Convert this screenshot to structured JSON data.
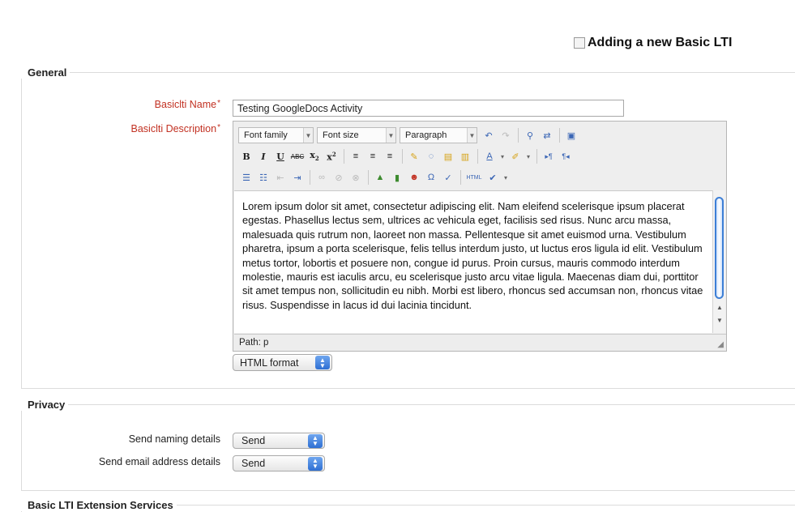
{
  "page": {
    "title": "Adding a new Basic LTI"
  },
  "general": {
    "legend": "General",
    "name_label": "Basiclti Name",
    "name_value": "Testing GoogleDocs Activity",
    "description_label": "Basiclti Description",
    "required_marker": "*",
    "editor": {
      "font_family": "Font family",
      "font_size": "Font size",
      "paragraph": "Paragraph",
      "body": "Lorem ipsum dolor sit amet, consectetur adipiscing elit. Nam eleifend scelerisque ipsum placerat egestas. Phasellus lectus sem, ultrices ac vehicula eget, facilisis sed risus. Nunc arcu massa, malesuada quis rutrum non, laoreet non massa. Pellentesque sit amet euismod urna. Vestibulum pharetra, ipsum a porta scelerisque, felis tellus interdum justo, ut luctus eros ligula id elit. Vestibulum metus tortor, lobortis et posuere non, congue id purus. Proin cursus, mauris commodo interdum molestie, mauris est iaculis arcu, eu scelerisque justo arcu vitae ligula. Maecenas diam dui, porttitor sit amet tempus non, sollicitudin eu nibh. Morbi est libero, rhoncus sed accumsan non, rhoncus vitae risus. Suspendisse in lacus id dui lacinia tincidunt.",
      "path": "Path: p"
    },
    "format": "HTML format"
  },
  "privacy": {
    "legend": "Privacy",
    "naming_label": "Send naming details",
    "naming_value": "Send",
    "email_label": "Send email address details",
    "email_value": "Send"
  },
  "extension": {
    "legend": "Basic LTI Extension Services"
  }
}
